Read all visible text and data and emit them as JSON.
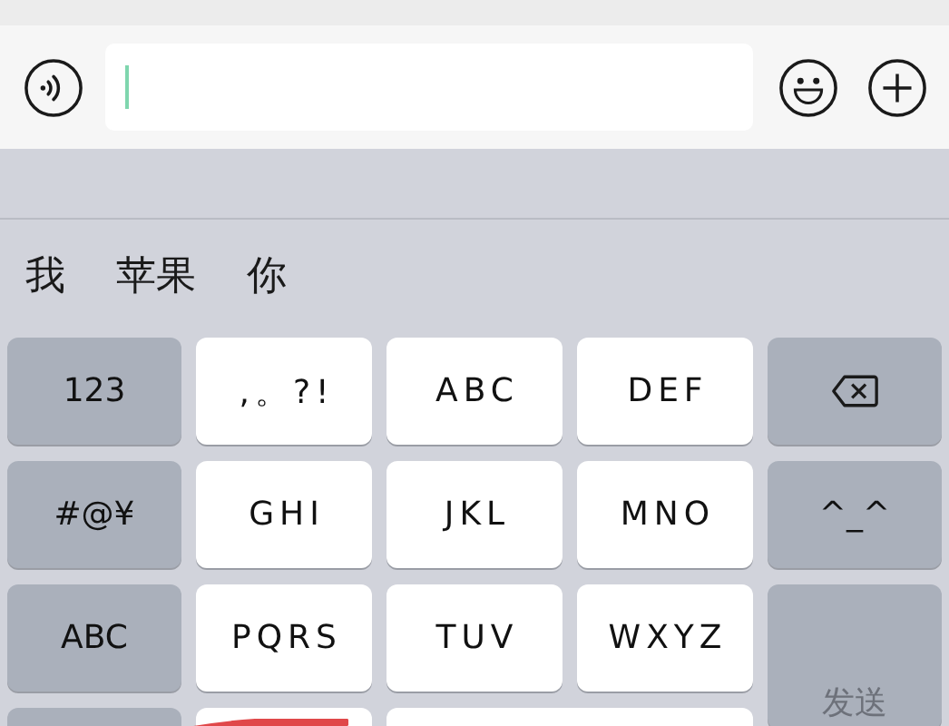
{
  "input_bar": {
    "field": {
      "focused": true
    }
  },
  "candidates": [
    "我",
    "苹果",
    "你"
  ],
  "keys": [
    {
      "kind": "function",
      "label": "123"
    },
    {
      "kind": "letter",
      "label": ",。?!"
    },
    {
      "kind": "letter",
      "label": "ABC"
    },
    {
      "kind": "letter",
      "label": "DEF"
    },
    {
      "kind": "delete"
    },
    {
      "kind": "function",
      "label": "#@¥"
    },
    {
      "kind": "letter",
      "label": "GHI"
    },
    {
      "kind": "letter",
      "label": "JKL"
    },
    {
      "kind": "letter",
      "label": "MNO"
    },
    {
      "kind": "function",
      "label": "^_^"
    },
    {
      "kind": "function",
      "label": "ABC"
    },
    {
      "kind": "letter",
      "label": "PQRS"
    },
    {
      "kind": "letter",
      "label": "TUV"
    },
    {
      "kind": "letter",
      "label": "WXYZ"
    },
    {
      "kind": "send",
      "label": "发送",
      "disabled": true
    },
    {
      "kind": "function_blank"
    },
    {
      "kind": "letter_blank",
      "marked": true
    },
    {
      "kind": "space"
    }
  ]
}
